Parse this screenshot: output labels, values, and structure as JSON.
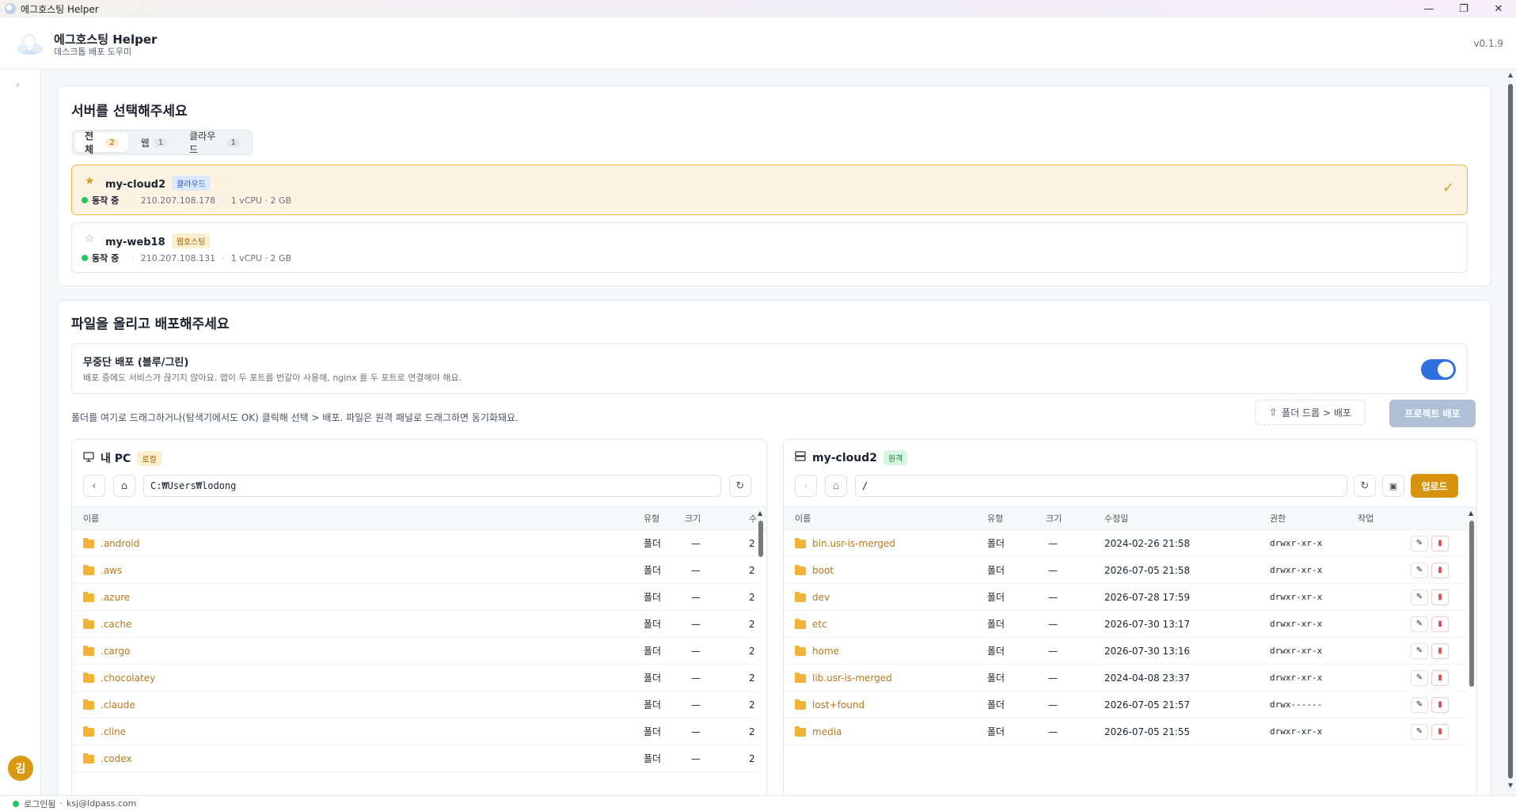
{
  "window": {
    "title": "에그호스팅 Helper",
    "controls": {
      "minimize": "—",
      "restore": "❐",
      "close": "✕"
    }
  },
  "header": {
    "title": "에그호스팅 Helper",
    "subtitle": "데스크톱 배포 도우미",
    "version": "v0.1.9"
  },
  "sidebar": {
    "expand_glyph": "›",
    "avatar_initial": "김"
  },
  "status_bar": {
    "login_state": "로그인됨",
    "separator": "·",
    "email": "ksj@ldpass.com"
  },
  "server_section": {
    "title": "서버를 선택해주세요",
    "tabs": [
      {
        "label": "전체",
        "count": "2"
      },
      {
        "label": "웹",
        "count": "1"
      },
      {
        "label": "클라우드",
        "count": "1"
      }
    ],
    "servers": [
      {
        "star": "★",
        "name": "my-cloud2",
        "type": "클라우드",
        "status": "동작 중",
        "ip": "210.207.108.178",
        "spec": "1 vCPU · 2 GB",
        "check": "✓"
      },
      {
        "star": "☆",
        "name": "my-web18",
        "type": "웹호스팅",
        "status": "동작 중",
        "ip": "210.207.108.131",
        "spec": "1 vCPU · 2 GB"
      }
    ],
    "sep": "·"
  },
  "deploy_section": {
    "title": "파일을 올리고 배포해주세요",
    "zero_downtime": {
      "title": "무중단 배포 (블루/그린)",
      "description": "배포 중에도 서비스가 끊기지 않아요. 앱이 두 포트를 번갈아 사용해, nginx 를 두 포트로 연결해야 해요."
    },
    "hint": "폴더를 여기로 드래그하거나(탐색기에서도 OK) 클릭해 선택 > 배포. 파일은 원격 패널로 드래그하면 동기화돼요.",
    "folder_drop_label": "폴더 드롭 > 배포",
    "project_deploy_label": "프로젝트 배포"
  },
  "local_panel": {
    "title": "내 PC",
    "badge": "로컬",
    "path": "C:₩Users₩lodong",
    "columns": {
      "name": "이름",
      "type": "유형",
      "size": "크기",
      "modified": "수"
    },
    "rows": [
      {
        "name": ".android",
        "type": "폴더",
        "size": "—",
        "modified": "2"
      },
      {
        "name": ".aws",
        "type": "폴더",
        "size": "—",
        "modified": "2"
      },
      {
        "name": ".azure",
        "type": "폴더",
        "size": "—",
        "modified": "2"
      },
      {
        "name": ".cache",
        "type": "폴더",
        "size": "—",
        "modified": "2"
      },
      {
        "name": ".cargo",
        "type": "폴더",
        "size": "—",
        "modified": "2"
      },
      {
        "name": ".chocolatey",
        "type": "폴더",
        "size": "—",
        "modified": "2"
      },
      {
        "name": ".claude",
        "type": "폴더",
        "size": "—",
        "modified": "2"
      },
      {
        "name": ".cline",
        "type": "폴더",
        "size": "—",
        "modified": "2"
      },
      {
        "name": ".codex",
        "type": "폴더",
        "size": "—",
        "modified": "2"
      }
    ]
  },
  "remote_panel": {
    "title": "my-cloud2",
    "badge": "원격",
    "path": "/",
    "upload_label": "업로드",
    "columns": {
      "name": "이름",
      "type": "유형",
      "size": "크기",
      "modified": "수정일",
      "perm": "권한",
      "actions": "작업"
    },
    "rows": [
      {
        "name": "bin.usr-is-merged",
        "type": "폴더",
        "size": "—",
        "modified": "2024-02-26 21:58",
        "perm": "drwxr-xr-x"
      },
      {
        "name": "boot",
        "type": "폴더",
        "size": "—",
        "modified": "2026-07-05 21:58",
        "perm": "drwxr-xr-x"
      },
      {
        "name": "dev",
        "type": "폴더",
        "size": "—",
        "modified": "2026-07-28 17:59",
        "perm": "drwxr-xr-x"
      },
      {
        "name": "etc",
        "type": "폴더",
        "size": "—",
        "modified": "2026-07-30 13:17",
        "perm": "drwxr-xr-x"
      },
      {
        "name": "home",
        "type": "폴더",
        "size": "—",
        "modified": "2026-07-30 13:16",
        "perm": "drwxr-xr-x"
      },
      {
        "name": "lib.usr-is-merged",
        "type": "폴더",
        "size": "—",
        "modified": "2024-04-08 23:37",
        "perm": "drwxr-xr-x"
      },
      {
        "name": "lost+found",
        "type": "폴더",
        "size": "—",
        "modified": "2026-07-05 21:57",
        "perm": "drwx------"
      },
      {
        "name": "media",
        "type": "폴더",
        "size": "—",
        "modified": "2026-07-05 21:55",
        "perm": "drwxr-xr-x"
      }
    ]
  },
  "icons": {
    "nav_back": "‹",
    "nav_home": "⌂",
    "refresh": "↻",
    "new_folder": "▣",
    "edit": "✎",
    "delete": "▮",
    "upload": "⇧"
  }
}
